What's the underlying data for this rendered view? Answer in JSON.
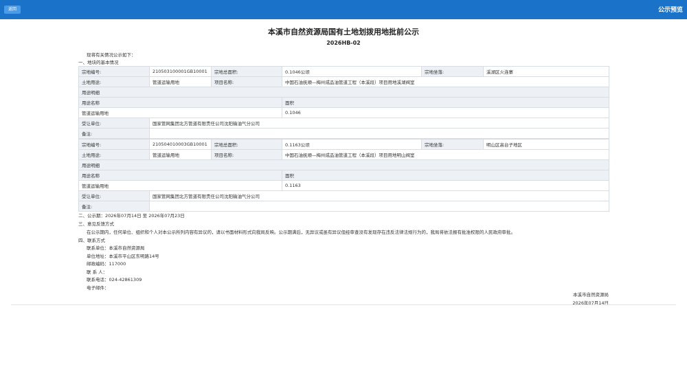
{
  "topbar": {
    "back_label": "返回",
    "title": "公示预览"
  },
  "doc": {
    "title": "本溪市自然资源局国有土地划拨用地批前公示",
    "number": "2026HB-02",
    "intro": "现将有关情况公示如下：",
    "section1": "一、地块的基本情况"
  },
  "labels": {
    "parcel_no": "宗地编号:",
    "total_area": "宗地总面积:",
    "location": "宗地坐落:",
    "land_use": "土地用途:",
    "project_name": "项目名称:",
    "use_detail": "用途明细",
    "use_name": "用途名称",
    "area": "面积",
    "assignee": "受让单位:",
    "remarks": "备注:"
  },
  "parcels": [
    {
      "parcel_no": "210503100001GB10001",
      "total_area": "0.1046公顷",
      "location": "溪湖区火连寨",
      "land_use": "管道运输用地",
      "project_name": "中国石油抚顺—梅州成品油管道工程（本溪段）项目用地溪湖阀室",
      "use_name": "管道运输用地",
      "use_area": "0.1046",
      "assignee": "国家管网集团北方管道有限责任公司沈阳输油气分公司",
      "remarks": ""
    },
    {
      "parcel_no": "210504010003GB10001",
      "total_area": "0.1163公顷",
      "location": "明山区高台子地区",
      "land_use": "管道运输用地",
      "project_name": "中国石油抚顺—梅州成品油管道工程（本溪段）项目用地明山阀室",
      "use_name": "管道运输用地",
      "use_area": "0.1163",
      "assignee": "国家管网集团北方管道有限责任公司沈阳输油气分公司",
      "remarks": ""
    }
  ],
  "period": "二、公示期：2026年07月14日 至 2026年07月23日",
  "feedback": {
    "heading": "三、意见反馈方式",
    "body": "在公示期内，任何单位、组织和个人对本公示所列内容有异议的，请以书面材料形式向我局反映。公示期满后，无异议或虽有异议但经审查没有发现存在违反法律法规行为的，我局将依法报有批准权限的人民政府审批。"
  },
  "contact": {
    "heading": "四、联系方式",
    "unit": "联系单位：本溪市自然资源局",
    "address": "单位地址：本溪市平山区东明路14号",
    "postcode": "邮政编码：117000",
    "person": "联 系 人：",
    "phone": "联系电话：024-42861309",
    "email": "电子邮件："
  },
  "signature": {
    "org": "本溪市自然资源局",
    "date": "2026年07月14日"
  }
}
